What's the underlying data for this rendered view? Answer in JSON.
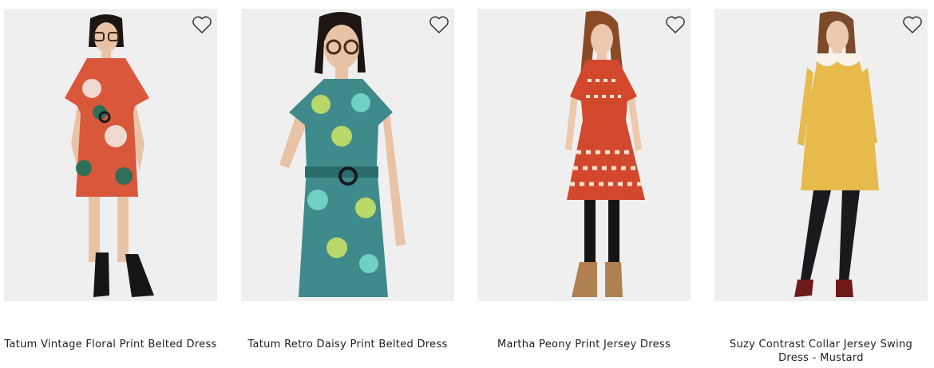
{
  "products": [
    {
      "name": "Tatum Vintage Floral Print Belted Dress",
      "icon": "heart-outline-icon",
      "dress_color": "#d9573a",
      "accent_color": "#2f6e58"
    },
    {
      "name": "Tatum Retro Daisy Print Belted Dress",
      "icon": "heart-outline-icon",
      "dress_color": "#3f8a8a",
      "accent_color": "#b9d86a"
    },
    {
      "name": "Martha Peony Print Jersey Dress",
      "icon": "heart-outline-icon",
      "dress_color": "#d2482c",
      "accent_color": "#f2e3cf"
    },
    {
      "name": "Suzy Contrast Collar Jersey Swing Dress - Mustard",
      "icon": "heart-outline-icon",
      "dress_color": "#e6bb4c",
      "accent_color": "#f7f3ea"
    }
  ]
}
